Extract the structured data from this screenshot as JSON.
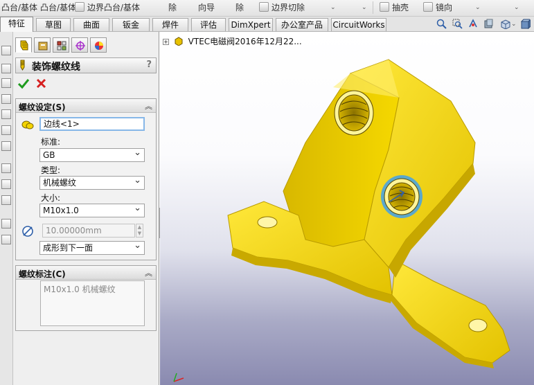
{
  "toolbar": {
    "items": [
      "凸台/基体",
      "凸台/基体",
      "边界凸台/基体",
      "除",
      "向导",
      "除",
      "边界切除",
      "抽壳",
      "镜向"
    ]
  },
  "tabs": [
    {
      "label": "特征",
      "active": true
    },
    {
      "label": "草图",
      "active": false
    },
    {
      "label": "曲面",
      "active": false
    },
    {
      "label": "钣金",
      "active": false
    },
    {
      "label": "焊件",
      "active": false
    },
    {
      "label": "评估",
      "active": false
    },
    {
      "label": "DimXpert",
      "active": false
    },
    {
      "label": "办公室产品",
      "active": false
    },
    {
      "label": "CircuitWorks",
      "active": false
    }
  ],
  "property_manager": {
    "title": "装饰螺纹线",
    "help": "?",
    "thread_settings": {
      "header": "螺纹设定(S)",
      "edge_value": "边线<1>",
      "standard_label": "标准:",
      "standard_value": "GB",
      "type_label": "类型:",
      "type_value": "机械螺纹",
      "size_label": "大小:",
      "size_value": "M10x1.0",
      "diameter_value": "10.00000mm",
      "end_condition_value": "成形到下一面"
    },
    "callout": {
      "header": "螺纹标注(C)",
      "text": "M10x1.0 机械螺纹"
    }
  },
  "viewport": {
    "tree_root": "VTEC电磁阀2016年12月22..."
  },
  "colors": {
    "part": "#f4d400",
    "part_shadow": "#b89a00",
    "thread_highlight": "#4aa3df",
    "ok": "#1e9b1e",
    "cancel": "#d61f1f"
  }
}
